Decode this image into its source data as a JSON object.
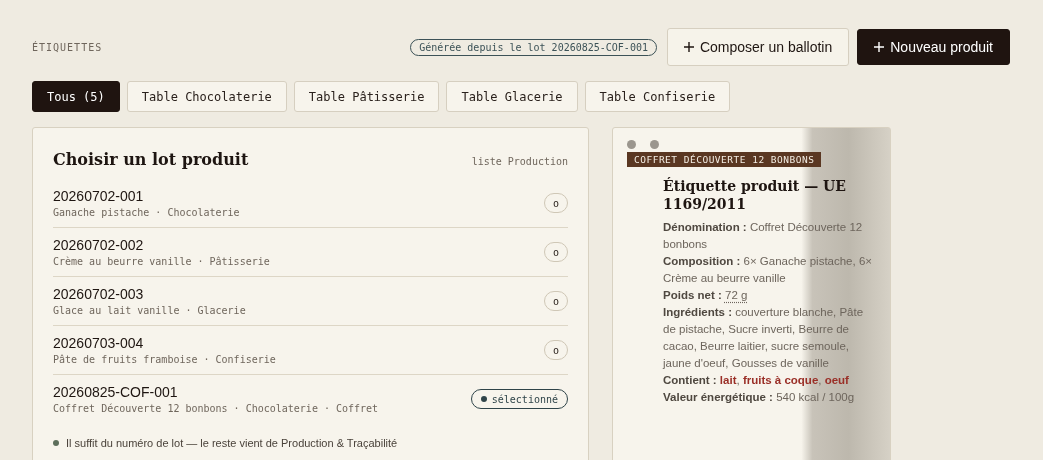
{
  "header": {
    "title": "ÉTIQUETTES",
    "source_badge": "Générée depuis le lot 20260825-COF-001",
    "buttons": [
      {
        "label": "Composer un ballotin",
        "kind": "secondary"
      },
      {
        "label": "Nouveau produit",
        "kind": "primary"
      }
    ]
  },
  "tabs": [
    {
      "label": "Tous (5)",
      "selected": true
    },
    {
      "label": "Table Chocolaterie",
      "selected": false
    },
    {
      "label": "Table Pâtisserie",
      "selected": false
    },
    {
      "label": "Table Glacerie",
      "selected": false
    },
    {
      "label": "Table Confiserie",
      "selected": false
    }
  ],
  "lot_panel": {
    "title": "Choisir un lot produit",
    "source": "liste Production",
    "lots": [
      {
        "number": "20260702-001",
        "details": "Ganache pistache · Chocolaterie",
        "selected": false,
        "status": "o"
      },
      {
        "number": "20260702-002",
        "details": "Crème au beurre vanille · Pâtisserie",
        "selected": false,
        "status": "o"
      },
      {
        "number": "20260702-003",
        "details": "Glace au lait vanille · Glacerie",
        "selected": false,
        "status": "o"
      },
      {
        "number": "20260703-004",
        "details": "Pâte de fruits framboise · Confiserie",
        "selected": false,
        "status": "o"
      },
      {
        "number": "20260825-COF-001",
        "details": "Coffret Découverte 12 bonbons · Chocolaterie · Coffret",
        "selected": true,
        "status": "sélectionné"
      }
    ],
    "hint": "Il suffit du numéro de lot — le reste vient de Production & Traçabilité"
  },
  "label_preview": {
    "tag": "COFFRET DÉCOUVERTE 12 BONBONS",
    "title": "Étiquette produit — UE 1169/2011",
    "fields": [
      {
        "label": "Dénomination :",
        "value": "Coffret Découverte 12 bonbons",
        "underlined": false
      },
      {
        "label": "Composition :",
        "value": "6× Ganache pistache, 6× Crème au beurre vanille",
        "underlined": false
      },
      {
        "label": "Poids net :",
        "value": "72 g",
        "underlined": true
      },
      {
        "label": "Ingrédients :",
        "value": "couverture blanche, Pâte de pistache, Sucre inverti, Beurre de cacao, Beurre laitier, sucre semoule, jaune d'oeuf, Gousses de vanille",
        "underlined": false
      },
      {
        "label": "Contient :",
        "value": "**lait**, **fruits à coque**, **oeuf**",
        "underlined": false
      },
      {
        "label": "Valeur énergétique :",
        "value": "540 kcal / 100g",
        "underlined": false
      }
    ]
  }
}
